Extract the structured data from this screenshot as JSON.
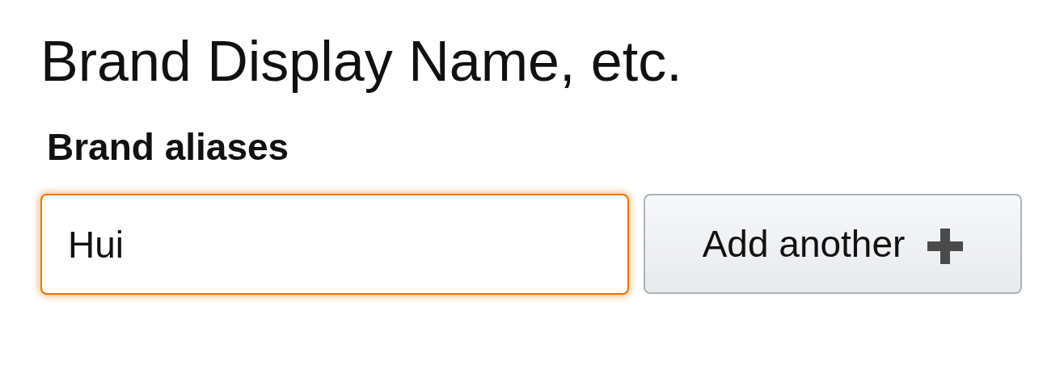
{
  "heading": "Brand Display Name, etc.",
  "field": {
    "label": "Brand aliases",
    "value": "Hui",
    "focused": true
  },
  "button": {
    "label": "Add another"
  }
}
